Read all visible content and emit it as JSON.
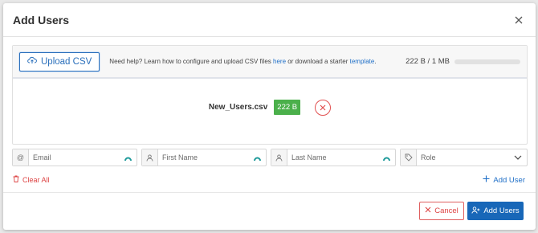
{
  "modal": {
    "title": "Add Users",
    "close_icon": "close-icon"
  },
  "upload": {
    "button_label": "Upload CSV",
    "icon": "cloud-upload-icon",
    "help_prefix": "Need help? Learn how to configure and upload CSV files ",
    "help_link_here": "here",
    "help_middle": " or download a starter ",
    "help_link_template": "template",
    "help_suffix": ".",
    "size_text": "222 B / 1 MB",
    "size_fraction": 0.0002
  },
  "file": {
    "name": "New_Users.csv",
    "size_badge": "222 B",
    "remove_icon": "close-circle-icon"
  },
  "fields": {
    "email": {
      "placeholder": "Email",
      "prefix": "@"
    },
    "first_name": {
      "placeholder": "First Name",
      "prefix_icon": "user-icon"
    },
    "last_name": {
      "placeholder": "Last Name",
      "prefix_icon": "user-icon"
    },
    "role": {
      "placeholder": "Role",
      "prefix_icon": "tag-icon",
      "suffix_icon": "chevron-down-icon"
    }
  },
  "actions": {
    "clear_all": "Clear All",
    "add_user": "Add User",
    "cancel": "Cancel",
    "add_users": "Add Users"
  },
  "colors": {
    "primary": "#1867b8",
    "danger": "#dd4444",
    "success": "#4bb04b",
    "teal_indicator": "#1e9a9a"
  }
}
